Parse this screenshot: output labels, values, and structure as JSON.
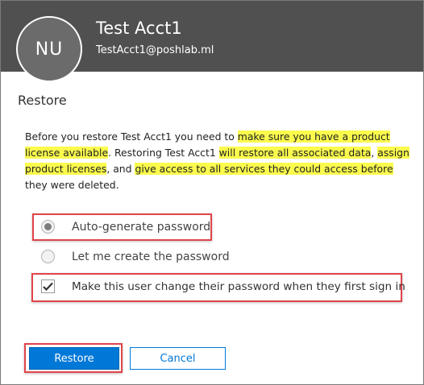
{
  "user": {
    "initials": "NU",
    "name": "Test Acct1",
    "email": "TestAcct1@poshlab.ml"
  },
  "panel": {
    "title": "Restore"
  },
  "description": {
    "p1": "Before you restore Test Acct1 you need to ",
    "h1": "make sure you have a product license available",
    "p2": ". Restoring Test Acct1 ",
    "h2": "will restore all associated data",
    "p3": ", ",
    "h3": "assign product licenses",
    "p4": ", and ",
    "h4": "give access to all services they could access before",
    "p5": " they were deleted."
  },
  "options": {
    "auto_generate": {
      "label": "Auto-generate password",
      "selected": true
    },
    "create_own": {
      "label": "Let me create the password",
      "selected": false
    },
    "force_change": {
      "label": "Make this user change their password when they first sign in",
      "checked": true
    }
  },
  "buttons": {
    "restore": "Restore",
    "cancel": "Cancel"
  },
  "colors": {
    "header_bg": "#505050",
    "accent": "#0078d7",
    "highlight": "#fbfb4d",
    "annotation": "#e0444a"
  }
}
